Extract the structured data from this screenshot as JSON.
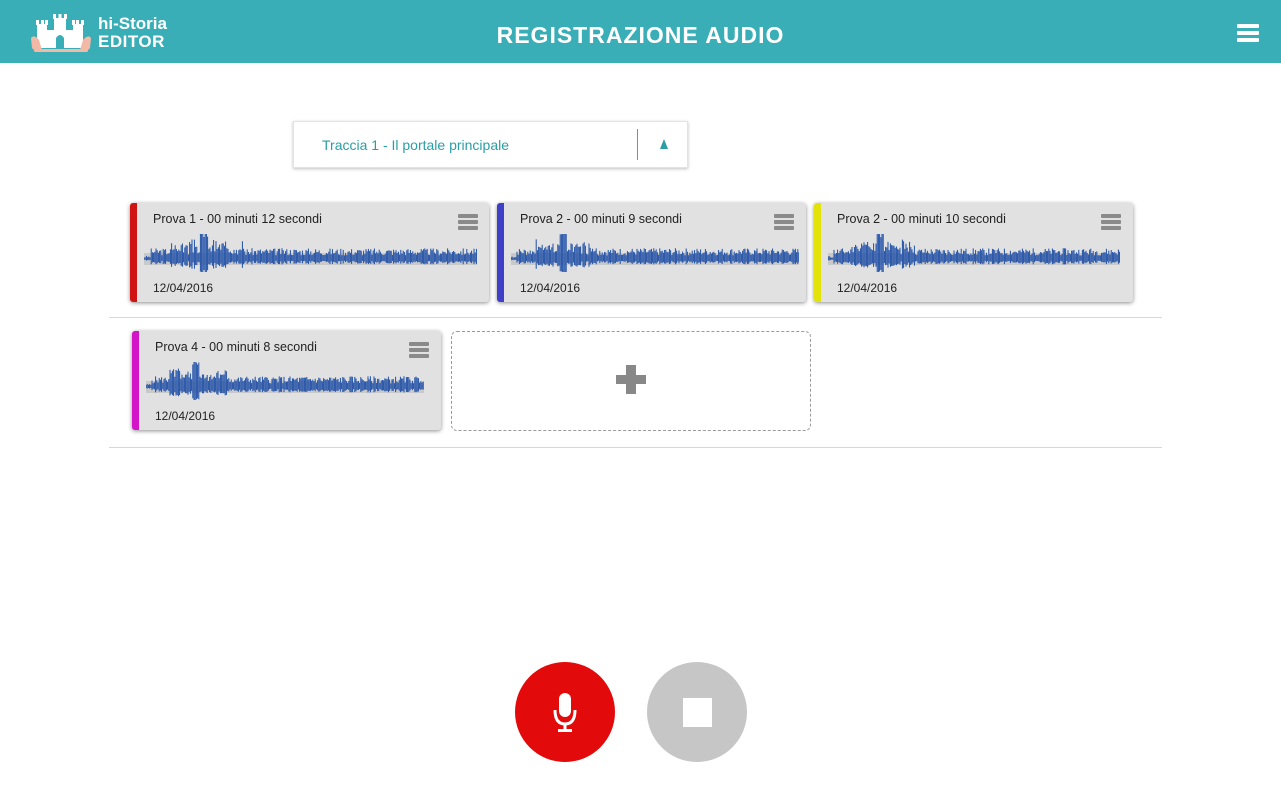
{
  "header": {
    "logo_line1": "hi-Storia",
    "logo_line2": "EDITOR",
    "title": "REGISTRAZIONE AUDIO",
    "menu_icon": "hamburger-menu-icon"
  },
  "track_selector": {
    "label": "Traccia 1 - Il portale principale",
    "caret_icon": "caret-up-icon"
  },
  "recordings": [
    {
      "title": "Prova 1 - 00 minuti 12 secondi",
      "date": "12/04/2016",
      "color": "#d01414"
    },
    {
      "title": "Prova 2 - 00 minuti 9 secondi",
      "date": "12/04/2016",
      "color": "#3f3fc8"
    },
    {
      "title": "Prova 2 - 00 minuti 10 secondi",
      "date": "12/04/2016",
      "color": "#e3e30a"
    },
    {
      "title": "Prova 4 - 00 minuti 8 secondi",
      "date": "12/04/2016",
      "color": "#d414c8"
    }
  ],
  "add_slot": {
    "icon": "plus-icon"
  },
  "controls": {
    "record_icon": "microphone-icon",
    "stop_icon": "stop-icon",
    "record_color": "#e20a0a",
    "stop_color": "#c6c6c6"
  },
  "colors": {
    "header_bg": "#3aaeb6",
    "accent_text": "#2a9ea6",
    "waveform": "#1f4fa8"
  }
}
